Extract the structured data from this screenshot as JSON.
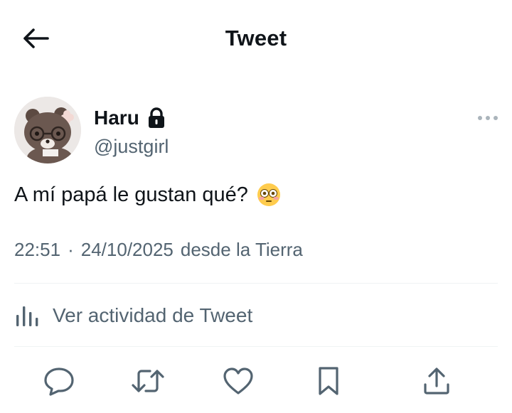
{
  "header": {
    "title": "Tweet",
    "back_icon": "arrow-left-icon"
  },
  "author": {
    "display_name": "Haru",
    "handle": "@justgirl",
    "protected_icon": "lock-icon",
    "avatar": "teddy-bear-with-glasses",
    "more_icon": "more-horizontal-icon"
  },
  "tweet": {
    "text": "A mí papá le gustan qué?",
    "emoji": "flushed-face-emoji"
  },
  "meta": {
    "time": "22:51",
    "separator": "·",
    "date": "24/10/2025",
    "source": "desde la Tierra"
  },
  "activity": {
    "label": "Ver actividad de Tweet",
    "icon": "analytics-icon"
  },
  "actions": [
    {
      "name": "reply",
      "icon": "reply-icon"
    },
    {
      "name": "retweet",
      "icon": "retweet-icon"
    },
    {
      "name": "like",
      "icon": "heart-icon"
    },
    {
      "name": "bookmark",
      "icon": "bookmark-icon"
    },
    {
      "name": "share",
      "icon": "share-icon"
    }
  ],
  "colors": {
    "text_primary": "#0f1419",
    "text_secondary": "#536471",
    "divider": "#eff3f4"
  }
}
